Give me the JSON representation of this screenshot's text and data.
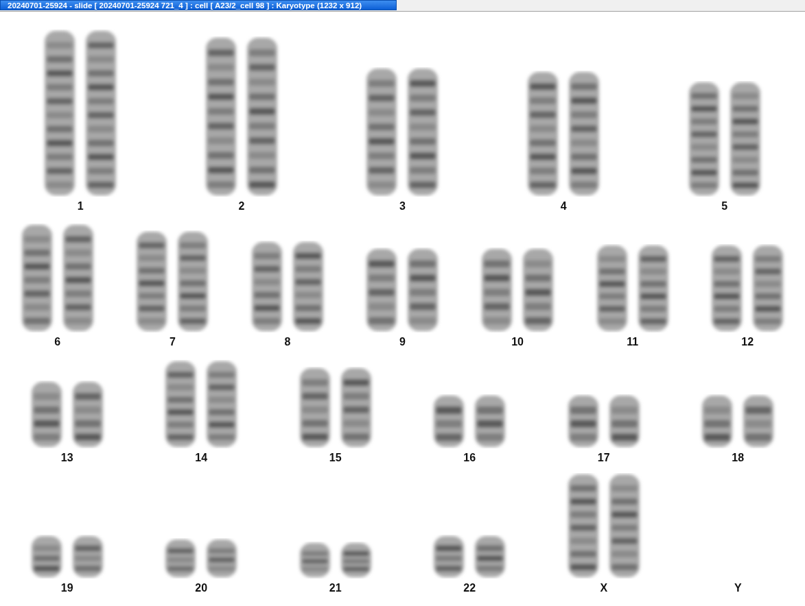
{
  "window": {
    "title": "20240701-25924 - slide [ 20240701-25924 721_4 ] : cell [ A23/2_cell 98 ] : Karyotype  (1232 x 912)"
  },
  "karyotype": {
    "rows": [
      {
        "pairs": [
          {
            "label": "1"
          },
          {
            "label": "2"
          },
          {
            "label": "3"
          },
          {
            "label": "4"
          },
          {
            "label": "5"
          }
        ]
      },
      {
        "pairs": [
          {
            "label": "6"
          },
          {
            "label": "7"
          },
          {
            "label": "8"
          },
          {
            "label": "9"
          },
          {
            "label": "10"
          },
          {
            "label": "11"
          },
          {
            "label": "12"
          }
        ]
      },
      {
        "pairs": [
          {
            "label": "13"
          },
          {
            "label": "14"
          },
          {
            "label": "15"
          },
          {
            "label": "16"
          },
          {
            "label": "17"
          },
          {
            "label": "18"
          }
        ]
      },
      {
        "pairs": [
          {
            "label": "19"
          },
          {
            "label": "20"
          },
          {
            "label": "21"
          },
          {
            "label": "22"
          },
          {
            "label": "X"
          },
          {
            "label": "Y"
          }
        ]
      }
    ]
  }
}
